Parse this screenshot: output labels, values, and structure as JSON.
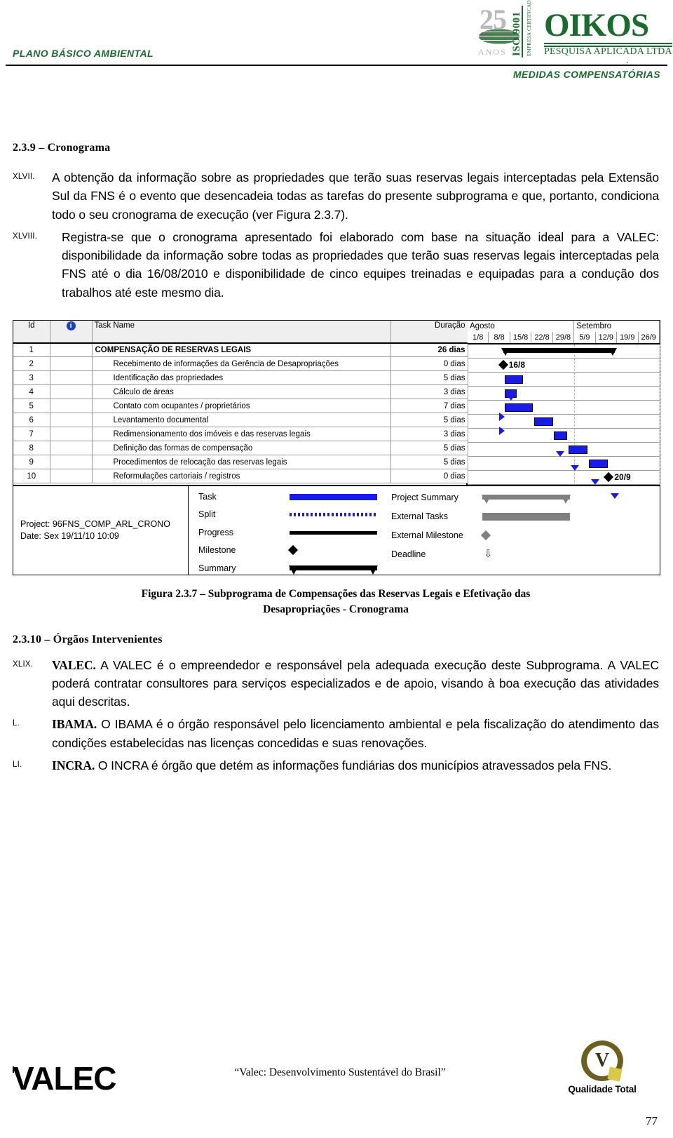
{
  "header": {
    "left_title": "PLANO BÁSICO AMBIENTAL",
    "right_title": "MEDIDAS COMPENSATÓRIAS",
    "logo": {
      "years_number": "25",
      "years_word": "ANOS",
      "iso_text": "ISO 9001",
      "iso_small_text": "EMPRESA CERTIFICADA",
      "brand": "OIKOS",
      "brand_sub": "PESQUISA APLICADA LTDA"
    }
  },
  "sections": {
    "cronograma_heading": "2.3.9 – Cronograma",
    "orgaos_heading": "2.3.10 – Órgãos Intervenientes"
  },
  "paragraphs": [
    {
      "roman": "XLVII.",
      "text": "A obtenção da informação sobre as propriedades que terão suas reservas legais interceptadas pela Extensão Sul da FNS é o evento que desencadeia todas as tarefas do presente subprograma e que, portanto, condiciona todo o seu cronograma de execução (ver Figura 2.3.7)."
    },
    {
      "roman": "XLVIII.",
      "text": "Registra-se que o cronograma apresentado foi elaborado com base na situação ideal para a VALEC: disponibilidade da informação sobre todas as propriedades que terão suas reservas legais interceptadas pela FNS até o dia 16/08/2010 e disponibilidade de cinco equipes treinadas e equipadas para a condução dos trabalhos até este mesmo dia."
    }
  ],
  "orgaos_paragraphs": [
    {
      "roman": "XLIX.",
      "lead": "VALEC.",
      "text": " A VALEC é o empreendedor e responsável pela adequada execução deste Subprograma. A VALEC poderá contratar consultores para serviços especializados e de apoio, visando à boa execução das atividades aqui descritas."
    },
    {
      "roman": "L.",
      "lead": "IBAMA.",
      "text": " O IBAMA é o órgão responsável pelo licenciamento ambiental e pela fiscalização do atendimento das condições estabelecidas nas licenças concedidas e suas renovações."
    },
    {
      "roman": "LI.",
      "lead": "INCRA.",
      "text": " O INCRA é órgão que detém as informações fundiárias dos municípios atravessados pela FNS."
    }
  ],
  "figure": {
    "caption_line1": "Figura 2.3.7 – Subprograma de Compensações das Reservas Legais e Efetivação das",
    "caption_line2": "Desapropriações - Cronograma"
  },
  "chart_data": {
    "type": "gantt",
    "title": "Subprograma de Compensações das Reservas Legais e Efetivação das Desapropriações - Cronograma",
    "columns": [
      "Id",
      "i",
      "Task Name",
      "Duração"
    ],
    "column_headers": {
      "id": "Id",
      "info": "i",
      "task_name": "Task Name",
      "duration": "Duração"
    },
    "timeline": {
      "months": [
        "Agosto",
        "Setembro"
      ],
      "weeks": [
        "1/8",
        "8/8",
        "15/8",
        "22/8",
        "29/8",
        "5/9",
        "12/9",
        "19/9",
        "26/9"
      ]
    },
    "tasks": [
      {
        "id": "1",
        "name": "COMPENSAÇÃO DE RESERVAS LEGAIS",
        "duration": "26 dias",
        "level": 1,
        "bar_type": "summary",
        "start_pct": 18.5,
        "width_pct": 58.0
      },
      {
        "id": "2",
        "name": "Recebimento de informações da Gerência de Desapropriações",
        "duration": "0 dias",
        "level": 2,
        "bar_type": "milestone",
        "start_pct": 18.5,
        "width_pct": 0,
        "label": "16/8"
      },
      {
        "id": "3",
        "name": "Identificação das propriedades",
        "duration": "5 dias",
        "level": 2,
        "bar_type": "task",
        "start_pct": 19.5,
        "width_pct": 9.5
      },
      {
        "id": "4",
        "name": "Cálculo de áreas",
        "duration": "3 dias",
        "level": 2,
        "bar_type": "task",
        "start_pct": 19.5,
        "width_pct": 6.0
      },
      {
        "id": "5",
        "name": "Contato com ocupantes / proprietários",
        "duration": "7 dias",
        "level": 2,
        "bar_type": "task",
        "start_pct": 19.5,
        "width_pct": 14.5
      },
      {
        "id": "6",
        "name": "Levantamento documental",
        "duration": "5 dias",
        "level": 2,
        "bar_type": "task",
        "start_pct": 34.5,
        "width_pct": 10.0
      },
      {
        "id": "7",
        "name": "Redimensionamento dos imóveis e das reservas legais",
        "duration": "3 dias",
        "level": 2,
        "bar_type": "task",
        "start_pct": 45.0,
        "width_pct": 7.0
      },
      {
        "id": "8",
        "name": "Definição das formas de compensação",
        "duration": "5 dias",
        "level": 2,
        "bar_type": "task",
        "start_pct": 52.5,
        "width_pct": 10.0
      },
      {
        "id": "9",
        "name": "Procedimentos de relocação das reservas legais",
        "duration": "5 dias",
        "level": 2,
        "bar_type": "task",
        "start_pct": 63.0,
        "width_pct": 10.0
      },
      {
        "id": "10",
        "name": "Reformulações cartoriais / registros",
        "duration": "0 dias",
        "level": 2,
        "bar_type": "milestone",
        "start_pct": 73.5,
        "width_pct": 0,
        "label": "20/9"
      }
    ],
    "project_info": {
      "project_label": "Project: 96FNS_COMP_ARL_CRONO",
      "date_label": "Date: Sex 19/11/10 10:09"
    },
    "legend": [
      {
        "label": "Task",
        "swatch": "task"
      },
      {
        "label": "Split",
        "swatch": "split"
      },
      {
        "label": "Progress",
        "swatch": "progress"
      },
      {
        "label": "Milestone",
        "swatch": "milestone"
      },
      {
        "label": "Summary",
        "swatch": "summary"
      },
      {
        "label": "Project Summary",
        "swatch": "project-summary"
      },
      {
        "label": "External Tasks",
        "swatch": "external-tasks"
      },
      {
        "label": "External Milestone",
        "swatch": "external-milestone"
      },
      {
        "label": "Deadline",
        "swatch": "deadline"
      }
    ],
    "colors": {
      "task_bar": "#1a1ae6",
      "summary_bar": "#000000",
      "external": "#808080",
      "grid": "#9a9a9a"
    }
  },
  "footer": {
    "valec_wordmark": "VALEC",
    "motto": "“Valec: Desenvolvimento Sustentável do Brasil”",
    "quality_label": "Qualidade Total",
    "quality_letter": "V",
    "page_number": "77"
  }
}
